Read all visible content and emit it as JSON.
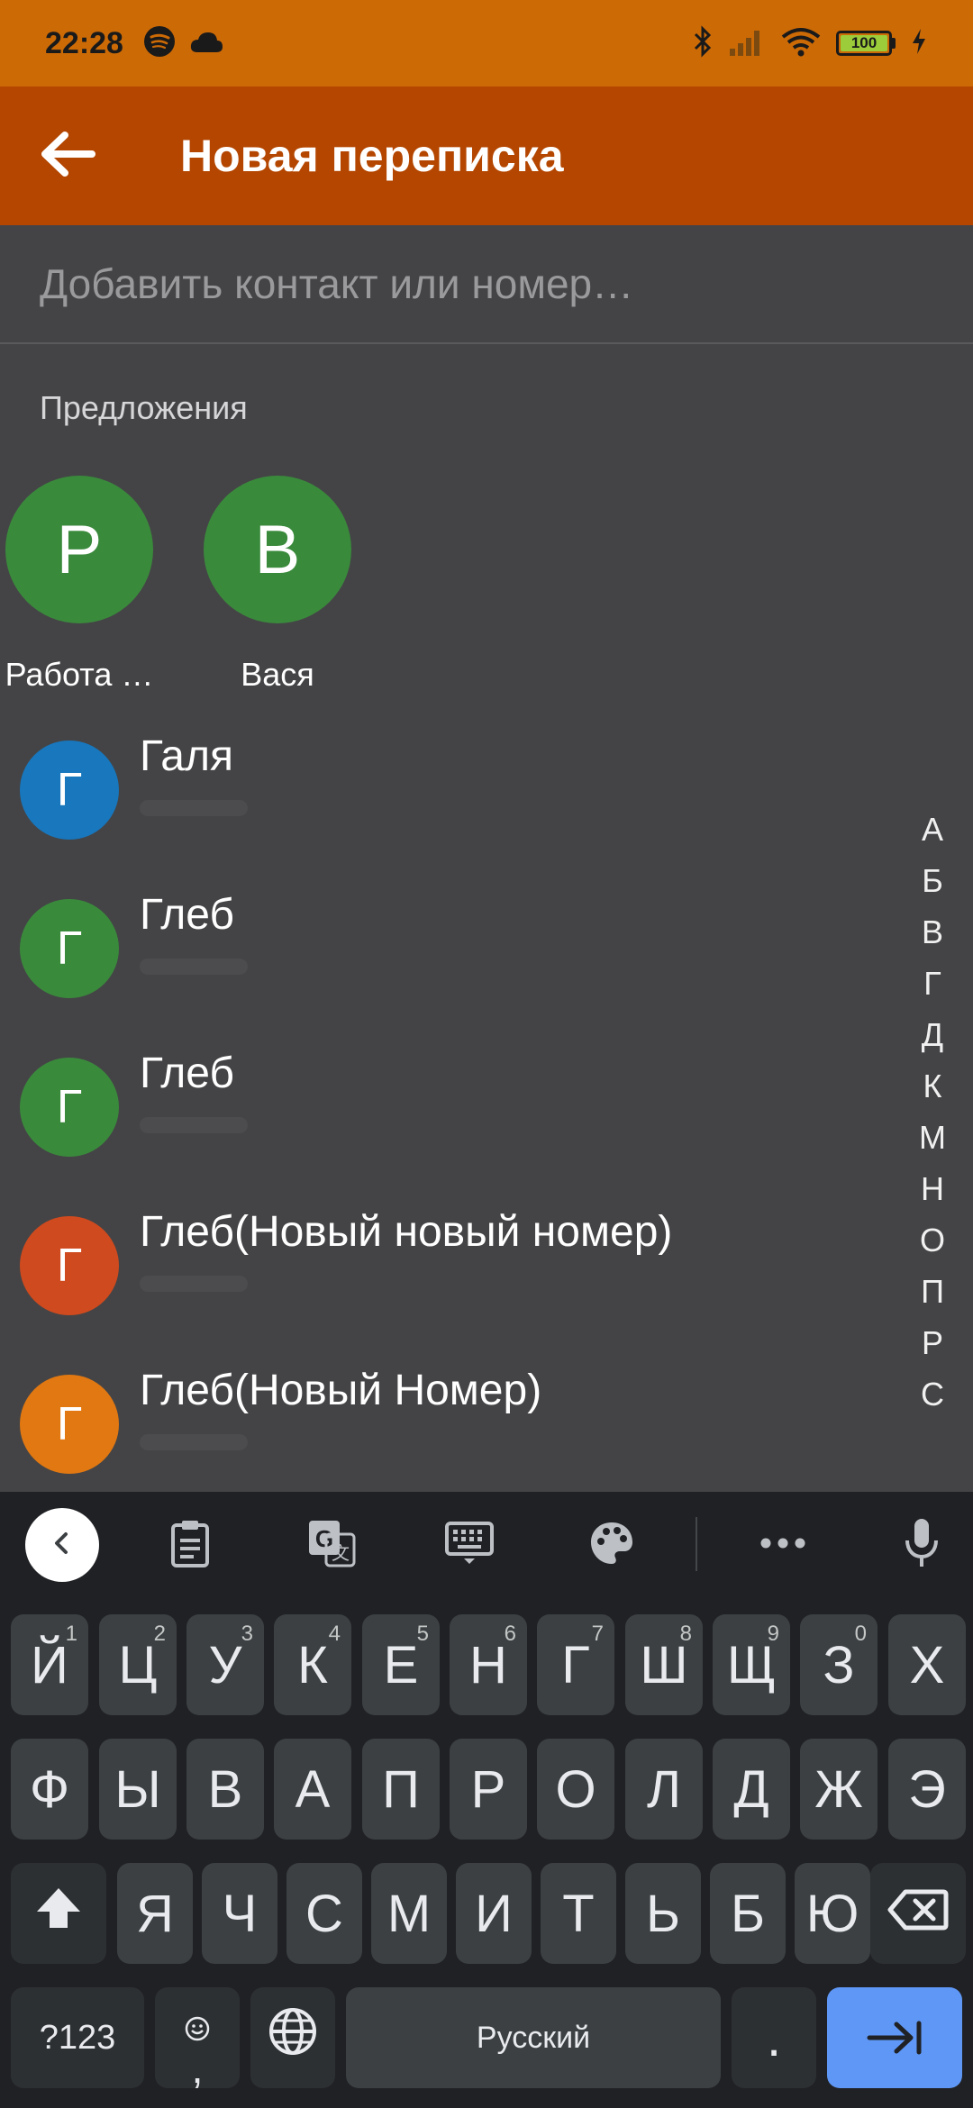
{
  "status_bar": {
    "time": "22:28",
    "left_icons": [
      "spotify-icon",
      "cloud-icon"
    ],
    "right_icons": [
      "bluetooth-icon",
      "signal-icon",
      "wifi-icon",
      "battery-icon",
      "charging-icon"
    ],
    "battery_level": "100"
  },
  "app_bar": {
    "title": "Новая переписка",
    "back_icon": "arrow-left-icon"
  },
  "search": {
    "placeholder": "Добавить контакт или номер…",
    "value": ""
  },
  "suggestions": {
    "title": "Предложения",
    "items": [
      {
        "initial": "Р",
        "name": "Работа …",
        "color": "#3a8a3c"
      },
      {
        "initial": "В",
        "name": "Вася",
        "color": "#3a8a3c"
      }
    ]
  },
  "contacts": [
    {
      "initial": "Г",
      "name": "Галя",
      "color": "#1877bd"
    },
    {
      "initial": "Г",
      "name": "Глеб",
      "color": "#3a8a3c"
    },
    {
      "initial": "Г",
      "name": "Глеб",
      "color": "#3a8a3c"
    },
    {
      "initial": "Г",
      "name": "Глеб(Новый новый номер)",
      "color": "#cf4a1e"
    },
    {
      "initial": "Г",
      "name": "Глеб(Новый Номер)",
      "color": "#e17812"
    }
  ],
  "alphabet_index": [
    "А",
    "Б",
    "В",
    "Г",
    "Д",
    "К",
    "М",
    "Н",
    "О",
    "П",
    "Р",
    "С"
  ],
  "keyboard": {
    "toolbar_icons": [
      "chevron-left-icon",
      "clipboard-icon",
      "translate-icon",
      "keyboard-icon",
      "palette-icon",
      "more-icon",
      "mic-icon"
    ],
    "row1": [
      {
        "label": "Й",
        "sup": "1"
      },
      {
        "label": "Ц",
        "sup": "2"
      },
      {
        "label": "У",
        "sup": "3"
      },
      {
        "label": "К",
        "sup": "4"
      },
      {
        "label": "Е",
        "sup": "5"
      },
      {
        "label": "Н",
        "sup": "6"
      },
      {
        "label": "Г",
        "sup": "7"
      },
      {
        "label": "Ш",
        "sup": "8"
      },
      {
        "label": "Щ",
        "sup": "9"
      },
      {
        "label": "З",
        "sup": "0"
      },
      {
        "label": "Х",
        "sup": ""
      }
    ],
    "row2": [
      "Ф",
      "Ы",
      "В",
      "А",
      "П",
      "Р",
      "О",
      "Л",
      "Д",
      "Ж",
      "Э"
    ],
    "row3": [
      "Я",
      "Ч",
      "С",
      "М",
      "И",
      "Т",
      "Ь",
      "Б",
      "Ю"
    ],
    "symbols_label": "?123",
    "emoji_sub": ",",
    "space_label": "Русский",
    "period_label": ".",
    "accent_color": "#5e97f6"
  }
}
